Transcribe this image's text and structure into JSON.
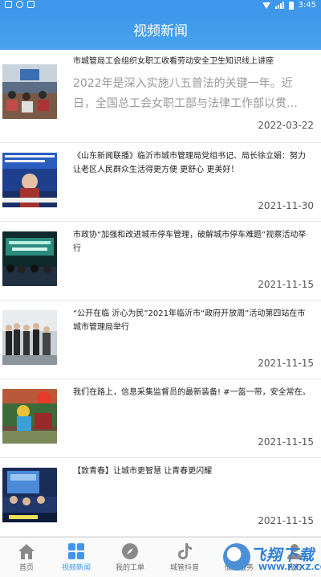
{
  "status": {
    "time": "3:45"
  },
  "header": {
    "title": "视频新闻"
  },
  "news": [
    {
      "title": "市城管局工会组织女职工收看劳动安全卫生知识线上讲座",
      "summary": "2022年是深入实施八五普法的关键一年。近日，全国总工会女职工部与法律工作部以贯…",
      "date": "2022-03-22"
    },
    {
      "title": "《山东新闻联播》临沂市城市管理局党组书记、局长徐立娟：努力让老区人民群众生活得更方便 更舒心 更美好！",
      "date": "2021-11-30"
    },
    {
      "title": "市政协“加强和改进城市停车管理，破解城市停车难题”视察活动举行",
      "date": "2021-11-15"
    },
    {
      "title": "“公开在临 沂心为民”2021年临沂市“政府开放周”活动第四站在市城市管理局举行",
      "date": "2021-11-15"
    },
    {
      "title": "我们在路上，信息采集监督员的最新装备! #一盔一带，安全常在。",
      "date": "2021-11-15"
    },
    {
      "title": "【致青春】让城市更智慧 让青春更闪耀",
      "date": "2021-11-15"
    }
  ],
  "tabs": [
    {
      "label": "首页",
      "icon": "home-icon"
    },
    {
      "label": "视频新闻",
      "icon": "grid-icon"
    },
    {
      "label": "我的工单",
      "icon": "compass-icon"
    },
    {
      "label": "城管抖音",
      "icon": "tiktok-icon"
    },
    {
      "label": "便民服务",
      "icon": "service-icon"
    },
    {
      "label": "我的",
      "icon": "user-icon"
    }
  ],
  "watermark": {
    "brand": "飞翔下载",
    "url": "WWW.FXXZ.COM"
  },
  "colors": {
    "accent": "#3e97ea",
    "active_tab": "#3e97ea"
  }
}
